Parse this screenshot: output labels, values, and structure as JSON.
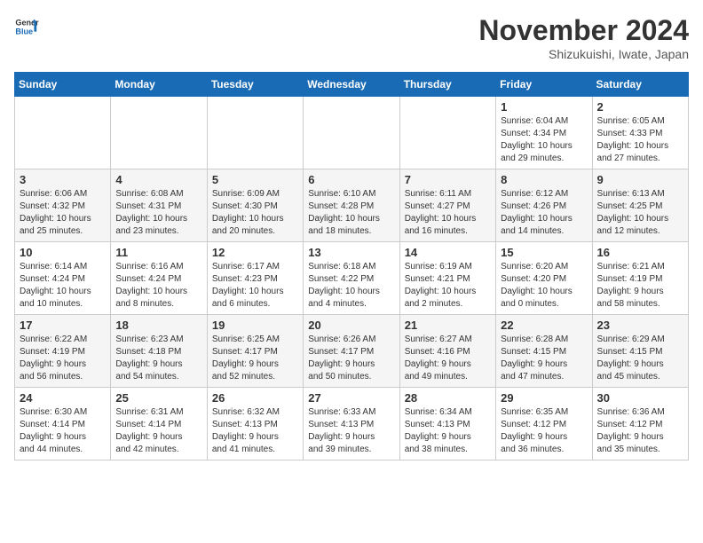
{
  "header": {
    "logo_line1": "General",
    "logo_line2": "Blue",
    "month": "November 2024",
    "location": "Shizukuishi, Iwate, Japan"
  },
  "weekdays": [
    "Sunday",
    "Monday",
    "Tuesday",
    "Wednesday",
    "Thursday",
    "Friday",
    "Saturday"
  ],
  "weeks": [
    [
      {
        "day": "",
        "info": ""
      },
      {
        "day": "",
        "info": ""
      },
      {
        "day": "",
        "info": ""
      },
      {
        "day": "",
        "info": ""
      },
      {
        "day": "",
        "info": ""
      },
      {
        "day": "1",
        "info": "Sunrise: 6:04 AM\nSunset: 4:34 PM\nDaylight: 10 hours\nand 29 minutes."
      },
      {
        "day": "2",
        "info": "Sunrise: 6:05 AM\nSunset: 4:33 PM\nDaylight: 10 hours\nand 27 minutes."
      }
    ],
    [
      {
        "day": "3",
        "info": "Sunrise: 6:06 AM\nSunset: 4:32 PM\nDaylight: 10 hours\nand 25 minutes."
      },
      {
        "day": "4",
        "info": "Sunrise: 6:08 AM\nSunset: 4:31 PM\nDaylight: 10 hours\nand 23 minutes."
      },
      {
        "day": "5",
        "info": "Sunrise: 6:09 AM\nSunset: 4:30 PM\nDaylight: 10 hours\nand 20 minutes."
      },
      {
        "day": "6",
        "info": "Sunrise: 6:10 AM\nSunset: 4:28 PM\nDaylight: 10 hours\nand 18 minutes."
      },
      {
        "day": "7",
        "info": "Sunrise: 6:11 AM\nSunset: 4:27 PM\nDaylight: 10 hours\nand 16 minutes."
      },
      {
        "day": "8",
        "info": "Sunrise: 6:12 AM\nSunset: 4:26 PM\nDaylight: 10 hours\nand 14 minutes."
      },
      {
        "day": "9",
        "info": "Sunrise: 6:13 AM\nSunset: 4:25 PM\nDaylight: 10 hours\nand 12 minutes."
      }
    ],
    [
      {
        "day": "10",
        "info": "Sunrise: 6:14 AM\nSunset: 4:24 PM\nDaylight: 10 hours\nand 10 minutes."
      },
      {
        "day": "11",
        "info": "Sunrise: 6:16 AM\nSunset: 4:24 PM\nDaylight: 10 hours\nand 8 minutes."
      },
      {
        "day": "12",
        "info": "Sunrise: 6:17 AM\nSunset: 4:23 PM\nDaylight: 10 hours\nand 6 minutes."
      },
      {
        "day": "13",
        "info": "Sunrise: 6:18 AM\nSunset: 4:22 PM\nDaylight: 10 hours\nand 4 minutes."
      },
      {
        "day": "14",
        "info": "Sunrise: 6:19 AM\nSunset: 4:21 PM\nDaylight: 10 hours\nand 2 minutes."
      },
      {
        "day": "15",
        "info": "Sunrise: 6:20 AM\nSunset: 4:20 PM\nDaylight: 10 hours\nand 0 minutes."
      },
      {
        "day": "16",
        "info": "Sunrise: 6:21 AM\nSunset: 4:19 PM\nDaylight: 9 hours\nand 58 minutes."
      }
    ],
    [
      {
        "day": "17",
        "info": "Sunrise: 6:22 AM\nSunset: 4:19 PM\nDaylight: 9 hours\nand 56 minutes."
      },
      {
        "day": "18",
        "info": "Sunrise: 6:23 AM\nSunset: 4:18 PM\nDaylight: 9 hours\nand 54 minutes."
      },
      {
        "day": "19",
        "info": "Sunrise: 6:25 AM\nSunset: 4:17 PM\nDaylight: 9 hours\nand 52 minutes."
      },
      {
        "day": "20",
        "info": "Sunrise: 6:26 AM\nSunset: 4:17 PM\nDaylight: 9 hours\nand 50 minutes."
      },
      {
        "day": "21",
        "info": "Sunrise: 6:27 AM\nSunset: 4:16 PM\nDaylight: 9 hours\nand 49 minutes."
      },
      {
        "day": "22",
        "info": "Sunrise: 6:28 AM\nSunset: 4:15 PM\nDaylight: 9 hours\nand 47 minutes."
      },
      {
        "day": "23",
        "info": "Sunrise: 6:29 AM\nSunset: 4:15 PM\nDaylight: 9 hours\nand 45 minutes."
      }
    ],
    [
      {
        "day": "24",
        "info": "Sunrise: 6:30 AM\nSunset: 4:14 PM\nDaylight: 9 hours\nand 44 minutes."
      },
      {
        "day": "25",
        "info": "Sunrise: 6:31 AM\nSunset: 4:14 PM\nDaylight: 9 hours\nand 42 minutes."
      },
      {
        "day": "26",
        "info": "Sunrise: 6:32 AM\nSunset: 4:13 PM\nDaylight: 9 hours\nand 41 minutes."
      },
      {
        "day": "27",
        "info": "Sunrise: 6:33 AM\nSunset: 4:13 PM\nDaylight: 9 hours\nand 39 minutes."
      },
      {
        "day": "28",
        "info": "Sunrise: 6:34 AM\nSunset: 4:13 PM\nDaylight: 9 hours\nand 38 minutes."
      },
      {
        "day": "29",
        "info": "Sunrise: 6:35 AM\nSunset: 4:12 PM\nDaylight: 9 hours\nand 36 minutes."
      },
      {
        "day": "30",
        "info": "Sunrise: 6:36 AM\nSunset: 4:12 PM\nDaylight: 9 hours\nand 35 minutes."
      }
    ]
  ]
}
